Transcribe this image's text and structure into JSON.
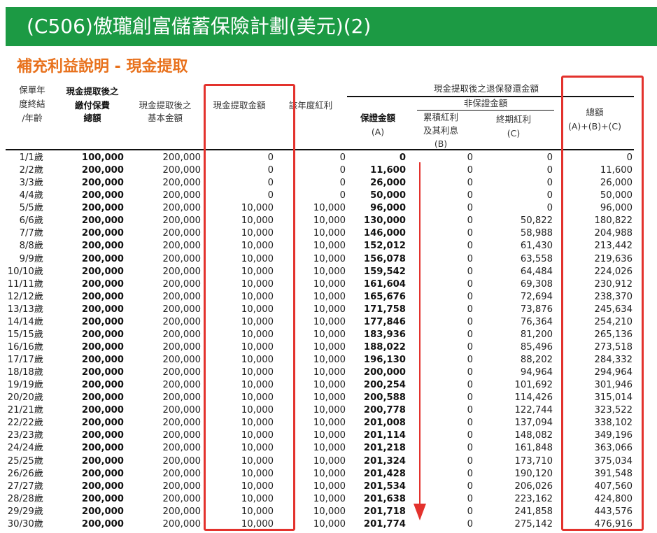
{
  "title": "(C506)傲瓏創富儲蓄保險計劃(美元)(2)",
  "subtitle": "補充利益說明 - 現金提取",
  "headers": {
    "year_age": [
      "保單年",
      "度終結",
      "/年齡"
    ],
    "premium": [
      "現金提取後之",
      "繳付保費",
      "總額"
    ],
    "basic": [
      "現金提取後之",
      "基本金額"
    ],
    "withdrawal": "現金提取金額",
    "dividend": "該年度紅利",
    "group": "現金提取後之退保發還金額",
    "non_guaranteed": "非保證金額",
    "guaranteed": [
      "保證金額",
      "(A)"
    ],
    "accumulated": [
      "累積紅利",
      "及其利息",
      "(B)"
    ],
    "terminal": [
      "終期紅利",
      "(C)"
    ],
    "total": [
      "總額",
      "(A)+(B)+(C)"
    ]
  },
  "rows": [
    [
      "1/1歲",
      "100,000",
      "200,000",
      "0",
      "0",
      "0",
      "0",
      "0",
      "0"
    ],
    [
      "2/2歲",
      "200,000",
      "200,000",
      "0",
      "0",
      "11,600",
      "0",
      "0",
      "11,600"
    ],
    [
      "3/3歲",
      "200,000",
      "200,000",
      "0",
      "0",
      "26,000",
      "0",
      "0",
      "26,000"
    ],
    [
      "4/4歲",
      "200,000",
      "200,000",
      "0",
      "0",
      "50,000",
      "0",
      "0",
      "50,000"
    ],
    [
      "5/5歲",
      "200,000",
      "200,000",
      "10,000",
      "10,000",
      "96,000",
      "0",
      "0",
      "96,000"
    ],
    [
      "6/6歲",
      "200,000",
      "200,000",
      "10,000",
      "10,000",
      "130,000",
      "0",
      "50,822",
      "180,822"
    ],
    [
      "7/7歲",
      "200,000",
      "200,000",
      "10,000",
      "10,000",
      "146,000",
      "0",
      "58,988",
      "204,988"
    ],
    [
      "8/8歲",
      "200,000",
      "200,000",
      "10,000",
      "10,000",
      "152,012",
      "0",
      "61,430",
      "213,442"
    ],
    [
      "9/9歲",
      "200,000",
      "200,000",
      "10,000",
      "10,000",
      "156,078",
      "0",
      "63,558",
      "219,636"
    ],
    [
      "10/10歲",
      "200,000",
      "200,000",
      "10,000",
      "10,000",
      "159,542",
      "0",
      "64,484",
      "224,026"
    ],
    [
      "11/11歲",
      "200,000",
      "200,000",
      "10,000",
      "10,000",
      "161,604",
      "0",
      "69,308",
      "230,912"
    ],
    [
      "12/12歲",
      "200,000",
      "200,000",
      "10,000",
      "10,000",
      "165,676",
      "0",
      "72,694",
      "238,370"
    ],
    [
      "13/13歲",
      "200,000",
      "200,000",
      "10,000",
      "10,000",
      "171,758",
      "0",
      "73,876",
      "245,634"
    ],
    [
      "14/14歲",
      "200,000",
      "200,000",
      "10,000",
      "10,000",
      "177,846",
      "0",
      "76,364",
      "254,210"
    ],
    [
      "15/15歲",
      "200,000",
      "200,000",
      "10,000",
      "10,000",
      "183,936",
      "0",
      "81,200",
      "265,136"
    ],
    [
      "16/16歲",
      "200,000",
      "200,000",
      "10,000",
      "10,000",
      "188,022",
      "0",
      "85,496",
      "273,518"
    ],
    [
      "17/17歲",
      "200,000",
      "200,000",
      "10,000",
      "10,000",
      "196,130",
      "0",
      "88,202",
      "284,332"
    ],
    [
      "18/18歲",
      "200,000",
      "200,000",
      "10,000",
      "10,000",
      "200,000",
      "0",
      "94,964",
      "294,964"
    ],
    [
      "19/19歲",
      "200,000",
      "200,000",
      "10,000",
      "10,000",
      "200,254",
      "0",
      "101,692",
      "301,946"
    ],
    [
      "20/20歲",
      "200,000",
      "200,000",
      "10,000",
      "10,000",
      "200,588",
      "0",
      "114,426",
      "315,014"
    ],
    [
      "21/21歲",
      "200,000",
      "200,000",
      "10,000",
      "10,000",
      "200,778",
      "0",
      "122,744",
      "323,522"
    ],
    [
      "22/22歲",
      "200,000",
      "200,000",
      "10,000",
      "10,000",
      "201,008",
      "0",
      "137,094",
      "338,102"
    ],
    [
      "23/23歲",
      "200,000",
      "200,000",
      "10,000",
      "10,000",
      "201,114",
      "0",
      "148,082",
      "349,196"
    ],
    [
      "24/24歲",
      "200,000",
      "200,000",
      "10,000",
      "10,000",
      "201,218",
      "0",
      "161,848",
      "363,066"
    ],
    [
      "25/25歲",
      "200,000",
      "200,000",
      "10,000",
      "10,000",
      "201,324",
      "0",
      "173,710",
      "375,034"
    ],
    [
      "26/26歲",
      "200,000",
      "200,000",
      "10,000",
      "10,000",
      "201,428",
      "0",
      "190,120",
      "391,548"
    ],
    [
      "27/27歲",
      "200,000",
      "200,000",
      "10,000",
      "10,000",
      "201,534",
      "0",
      "206,026",
      "407,560"
    ],
    [
      "28/28歲",
      "200,000",
      "200,000",
      "10,000",
      "10,000",
      "201,638",
      "0",
      "223,162",
      "424,800"
    ],
    [
      "29/29歲",
      "200,000",
      "200,000",
      "10,000",
      "10,000",
      "201,718",
      "0",
      "241,858",
      "443,576"
    ],
    [
      "30/30歲",
      "200,000",
      "200,000",
      "10,000",
      "10,000",
      "201,774",
      "0",
      "275,142",
      "476,916"
    ]
  ],
  "bold_columns": [
    1,
    5
  ],
  "colors": {
    "title_bg": "#1c9a44",
    "subtitle": "#e8711c",
    "highlight_box": "#e3322d"
  },
  "icons": {
    "annotation_arrow": "down-arrow-icon"
  }
}
